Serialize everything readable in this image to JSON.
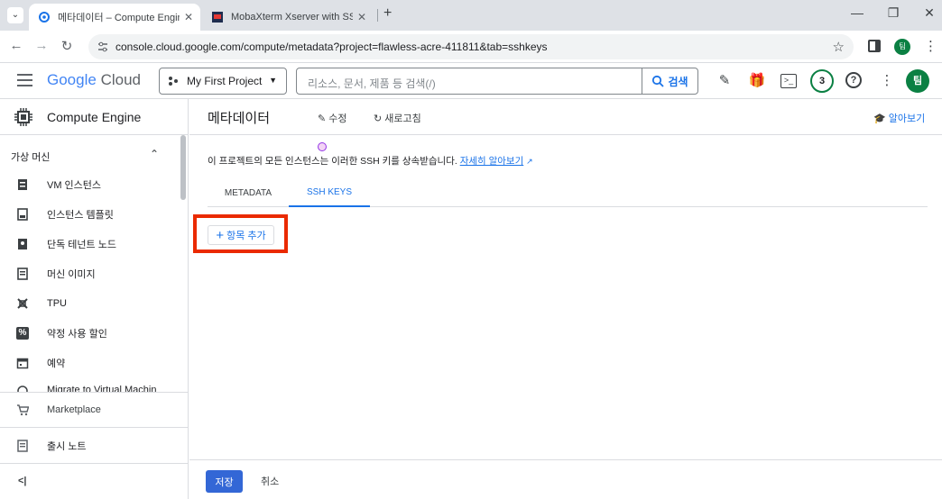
{
  "browser": {
    "tabs": [
      {
        "title": "메타데이터 – Compute Engine",
        "active": true
      },
      {
        "title": "MobaXterm Xserver with SSH",
        "active": false
      }
    ],
    "url": "console.cloud.google.com/compute/metadata?project=flawless-acre-411811&tab=sshkeys",
    "profile_initial": "팀"
  },
  "header": {
    "logo_google": "Google",
    "logo_cloud": "Cloud",
    "project": "My First Project",
    "search_placeholder": "리소스, 문서, 제품 등 검색(/)",
    "search_button": "검색",
    "notification_count": "3",
    "avatar_initial": "팀"
  },
  "sidebar": {
    "product": "Compute Engine",
    "section": "가상 머신",
    "items": [
      {
        "label": "VM 인스턴스",
        "icon": "vm-instance-icon"
      },
      {
        "label": "인스턴스 템플릿",
        "icon": "instance-template-icon"
      },
      {
        "label": "단독 테넌트 노드",
        "icon": "sole-tenant-icon"
      },
      {
        "label": "머신 이미지",
        "icon": "machine-image-icon"
      },
      {
        "label": "TPU",
        "icon": "tpu-icon"
      },
      {
        "label": "약정 사용 할인",
        "icon": "percent-icon"
      },
      {
        "label": "예약",
        "icon": "calendar-icon"
      },
      {
        "label": "Migrate to Virtual Machin",
        "icon": "migrate-icon"
      }
    ],
    "marketplace": "Marketplace",
    "release_notes": "출시 노트",
    "collapse": "<|"
  },
  "main": {
    "title": "메타데이터",
    "edit": "수정",
    "refresh": "새로고침",
    "learn": "알아보기",
    "info_text": "이 프로젝트의 모든 인스턴스는 이러한 SSH 키를 상속받습니다.",
    "info_link": "자세히 알아보기",
    "tabs": [
      {
        "label": "METADATA",
        "active": false
      },
      {
        "label": "SSH KEYS",
        "active": true
      }
    ],
    "add_item": "항목 추가",
    "save": "저장",
    "cancel": "취소"
  },
  "colors": {
    "accent": "#1a73e8",
    "highlight": "#ea2a00",
    "save": "#3367d6"
  }
}
